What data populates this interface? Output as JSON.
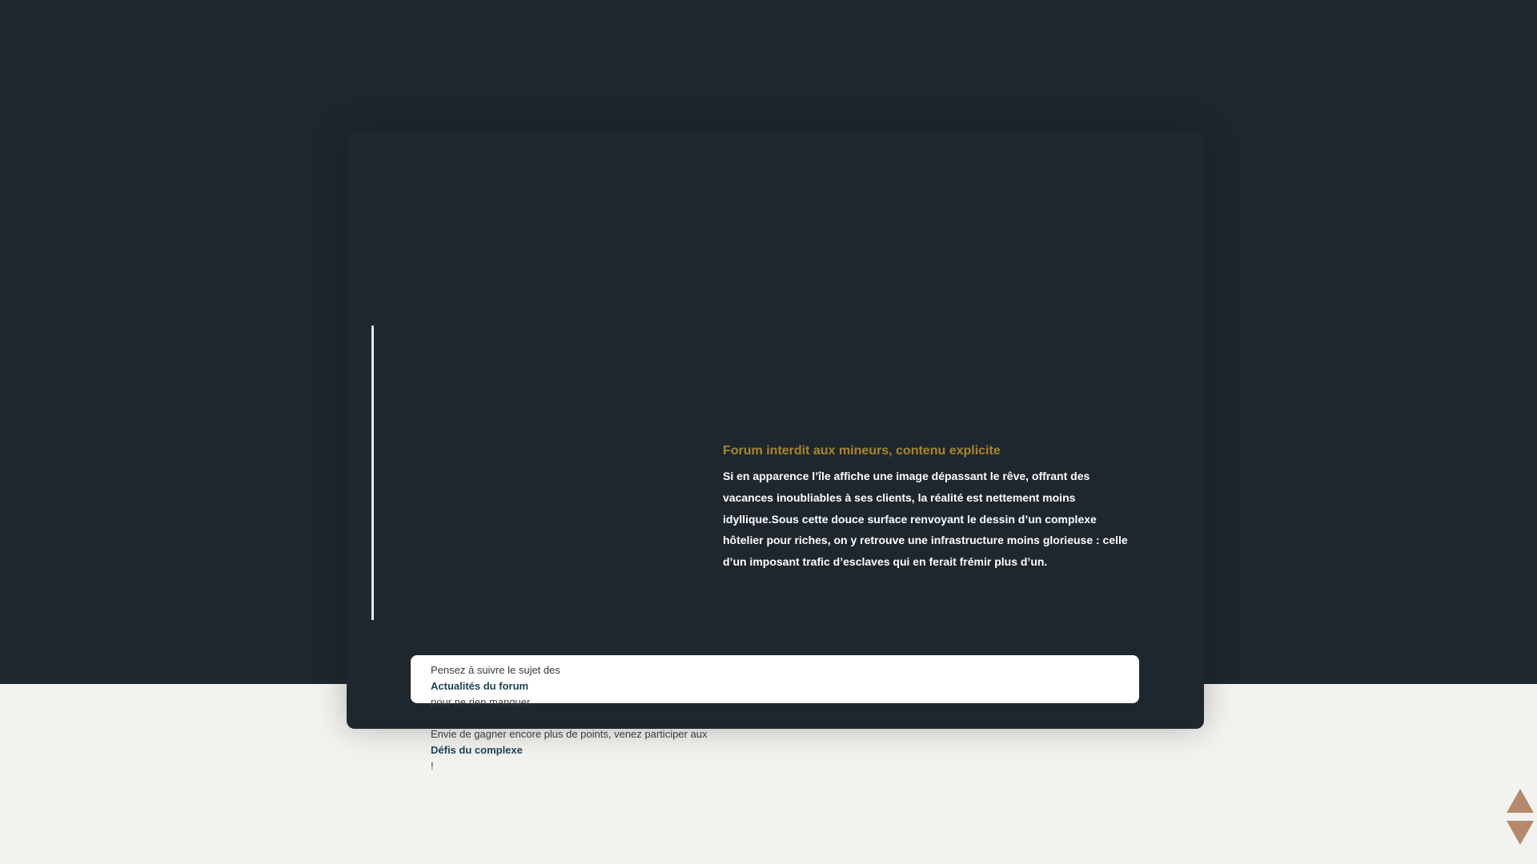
{
  "header": {
    "warning_title": "Forum interdit aux mineurs, contenu explicite",
    "description": "Si en apparence l’île affiche une image dépassant le rêve, offrant des vacances inoubliables à ses clients, la réalité est nettement moins idyllique.Sous cette douce surface renvoyant le dessin d’un complexe hôtelier pour riches, on y retrouve une infrastructure moins glorieuse : celle d’un imposant trafic d’esclaves qui en ferait frémir plus d’un."
  },
  "info": {
    "line1_prefix": "Pensez à suivre le sujet des",
    "line1_link": "Actualités du forum",
    "line1_suffix": "pour ne rien manquer.",
    "line2_prefix": "Envie de gagner encore plus de points, venez participer aux",
    "line2_link": "Défis du complexe",
    "line2_suffix": "!"
  },
  "scroll": {
    "up_icon": "triangle-up-icon",
    "down_icon": "triangle-down-icon"
  },
  "colors": {
    "dark_background": "#1f272e",
    "light_background": "#f2f2ef",
    "accent_gold": "#a8862e",
    "link": "#1b4454",
    "scroll_arrows": "#b58a6a"
  }
}
